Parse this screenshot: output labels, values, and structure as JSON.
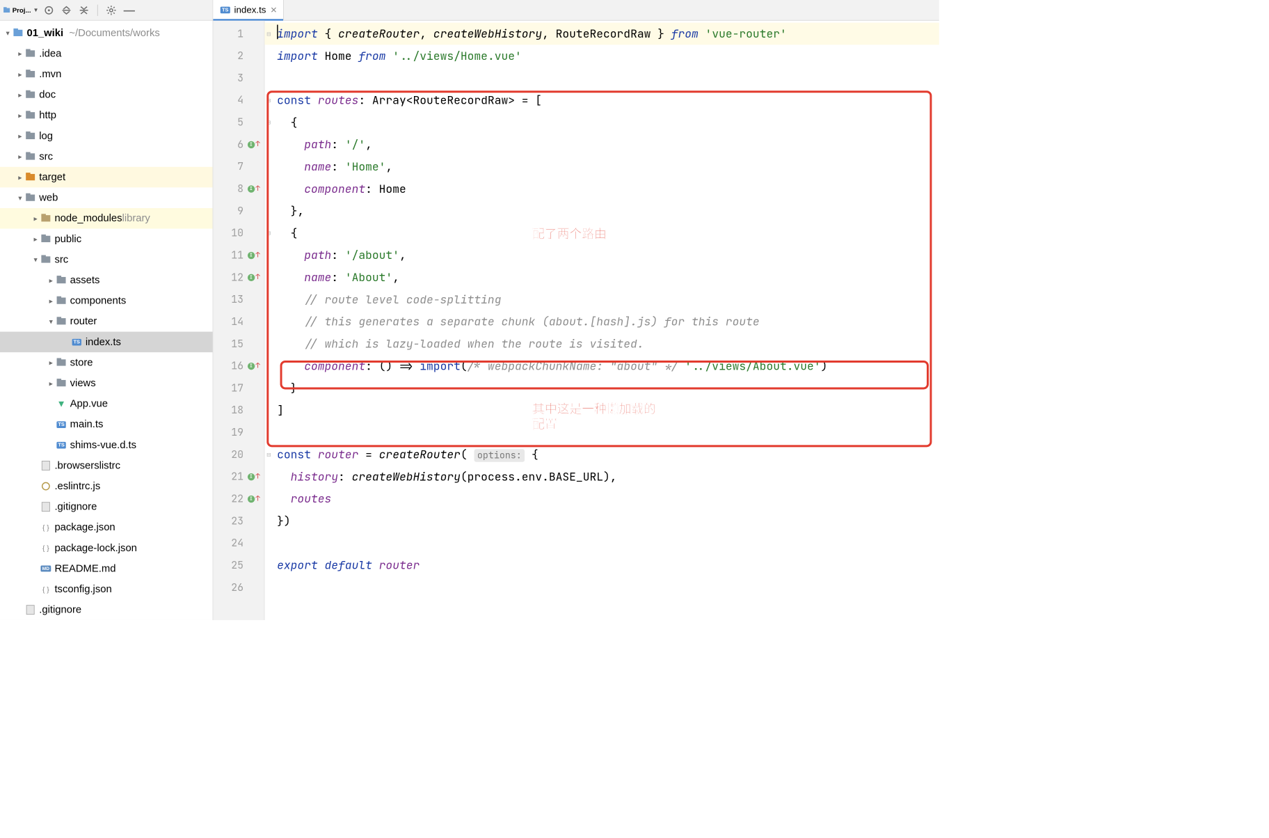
{
  "sidebar": {
    "title": "Proj...",
    "project_root": {
      "name": "01_wiki",
      "path": "~/Documents/works"
    },
    "items": [
      {
        "name": ".idea",
        "depth": 1,
        "icon": "folder",
        "expand": ">"
      },
      {
        "name": ".mvn",
        "depth": 1,
        "icon": "folder",
        "expand": ">"
      },
      {
        "name": "doc",
        "depth": 1,
        "icon": "folder",
        "expand": ">"
      },
      {
        "name": "http",
        "depth": 1,
        "icon": "folder",
        "expand": ">"
      },
      {
        "name": "log",
        "depth": 1,
        "icon": "folder",
        "expand": ">"
      },
      {
        "name": "src",
        "depth": 1,
        "icon": "folder-src",
        "expand": ">"
      },
      {
        "name": "target",
        "depth": 1,
        "icon": "folder-target",
        "expand": ">",
        "highlight": true
      },
      {
        "name": "web",
        "depth": 1,
        "icon": "folder",
        "expand": "v"
      },
      {
        "name": "node_modules",
        "suffix": "library",
        "depth": 2,
        "icon": "folder-lib",
        "expand": ">",
        "highlight2": true
      },
      {
        "name": "public",
        "depth": 2,
        "icon": "folder",
        "expand": ">"
      },
      {
        "name": "src",
        "depth": 2,
        "icon": "folder",
        "expand": "v"
      },
      {
        "name": "assets",
        "depth": 3,
        "icon": "folder",
        "expand": ">"
      },
      {
        "name": "components",
        "depth": 3,
        "icon": "folder",
        "expand": ">"
      },
      {
        "name": "router",
        "depth": 3,
        "icon": "folder",
        "expand": "v"
      },
      {
        "name": "index.ts",
        "depth": 4,
        "icon": "ts",
        "selected": true
      },
      {
        "name": "store",
        "depth": 3,
        "icon": "folder",
        "expand": ">"
      },
      {
        "name": "views",
        "depth": 3,
        "icon": "folder",
        "expand": ">"
      },
      {
        "name": "App.vue",
        "depth": 3,
        "icon": "vue"
      },
      {
        "name": "main.ts",
        "depth": 3,
        "icon": "ts"
      },
      {
        "name": "shims-vue.d.ts",
        "depth": 3,
        "icon": "ts"
      },
      {
        "name": ".browserslistrc",
        "depth": 2,
        "icon": "txt"
      },
      {
        "name": ".eslintrc.js",
        "depth": 2,
        "icon": "js"
      },
      {
        "name": ".gitignore",
        "depth": 2,
        "icon": "txt"
      },
      {
        "name": "package.json",
        "depth": 2,
        "icon": "json"
      },
      {
        "name": "package-lock.json",
        "depth": 2,
        "icon": "json"
      },
      {
        "name": "README.md",
        "depth": 2,
        "icon": "md"
      },
      {
        "name": "tsconfig.json",
        "depth": 2,
        "icon": "json"
      },
      {
        "name": ".gitignore",
        "depth": 1,
        "icon": "txt"
      }
    ]
  },
  "tab": {
    "filename": "index.ts"
  },
  "gutter": {
    "lines": 26,
    "marks": {
      "6": true,
      "8": true,
      "11": true,
      "12": true,
      "16": true,
      "21": true,
      "22": true
    }
  },
  "code": {
    "l1_1": "import",
    "l1_2": " { ",
    "l1_3": "createRouter",
    "l1_4": ", ",
    "l1_5": "createWebHistory",
    "l1_6": ", RouteRecordRaw } ",
    "l1_7": "from ",
    "l1_8": "'vue-router'",
    "l2_1": "import",
    "l2_2": " Home ",
    "l2_3": "from ",
    "l2_4": "'../views/Home.vue'",
    "l4_1": "const ",
    "l4_2": "routes",
    "l4_3": ": Array<RouteRecordRaw> = [",
    "l5": "  {",
    "l6_1": "    ",
    "l6_2": "path",
    "l6_3": ": ",
    "l6_4": "'/'",
    "l6_5": ",",
    "l7_1": "    ",
    "l7_2": "name",
    "l7_3": ": ",
    "l7_4": "'Home'",
    "l7_5": ",",
    "l8_1": "    ",
    "l8_2": "component",
    "l8_3": ": Home",
    "l9": "  },",
    "l10": "  {",
    "l11_1": "    ",
    "l11_2": "path",
    "l11_3": ": ",
    "l11_4": "'/about'",
    "l11_5": ",",
    "l12_1": "    ",
    "l12_2": "name",
    "l12_3": ": ",
    "l12_4": "'About'",
    "l12_5": ",",
    "l13": "    // route level code-splitting",
    "l14": "    // this generates a separate chunk (about.[hash].js) for this route",
    "l15": "    // which is lazy-loaded when the route is visited.",
    "l16_1": "    ",
    "l16_2": "component",
    "l16_3": ": () => ",
    "l16_4": "import",
    "l16_5": "(",
    "l16_6": "/* webpackChunkName: \"about\" */ ",
    "l16_7": "'../views/About.vue'",
    "l16_8": ")",
    "l17": "  }",
    "l18": "]",
    "l20_1": "const ",
    "l20_2": "router",
    "l20_3": " = ",
    "l20_4": "createRouter",
    "l20_5": "( ",
    "l20_hint": "options:",
    "l20_6": " {",
    "l21_1": "  ",
    "l21_2": "history",
    "l21_3": ": ",
    "l21_4": "createWebHistory",
    "l21_5": "(process.env.BASE_URL),",
    "l22_1": "  ",
    "l22_2": "routes",
    "l23": "})",
    "l25_1": "export default ",
    "l25_2": "router"
  },
  "annotations": {
    "a1": "配了两个路由",
    "a2_l1": "其中这是一种懒加载的",
    "a2_l2": "配置"
  }
}
